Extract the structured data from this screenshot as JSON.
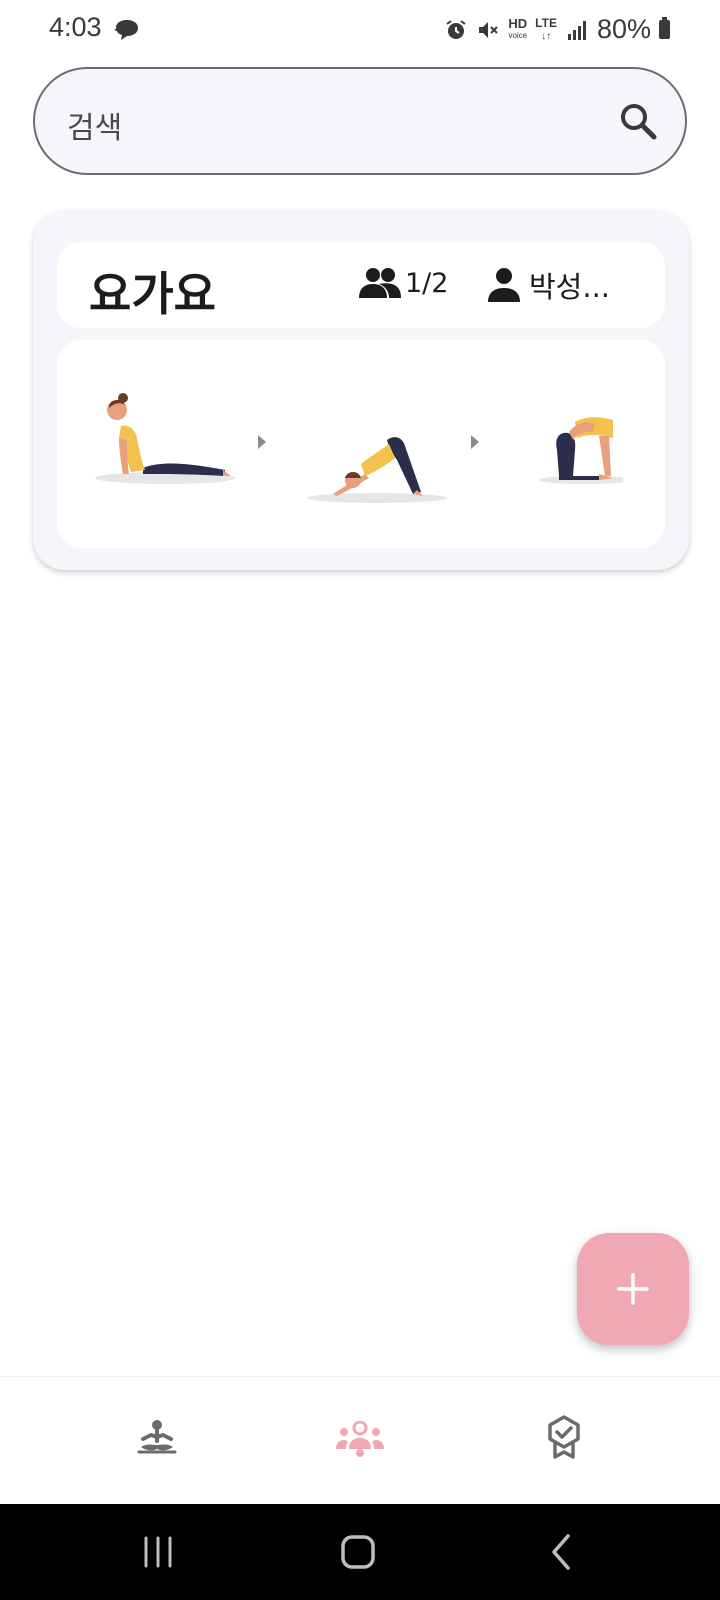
{
  "status_bar": {
    "time": "4:03",
    "hd_label": "HD",
    "hd_sub": "voice",
    "lte_label": "LTE",
    "battery": "80%"
  },
  "search": {
    "placeholder": "검색"
  },
  "room_card": {
    "title": "요가요",
    "members": "1/2",
    "owner": "박성..."
  },
  "fab": {
    "icon": "plus-icon"
  },
  "bottom_nav": {
    "items": [
      {
        "icon": "meditation-icon",
        "active": false
      },
      {
        "icon": "group-icon",
        "active": true
      },
      {
        "icon": "badge-icon",
        "active": false
      }
    ]
  },
  "colors": {
    "accent": "#f0a9b2",
    "card_bg": "#f6f6fa",
    "text": "#1c1c1e",
    "inactive_icon": "#6b6b6b"
  }
}
